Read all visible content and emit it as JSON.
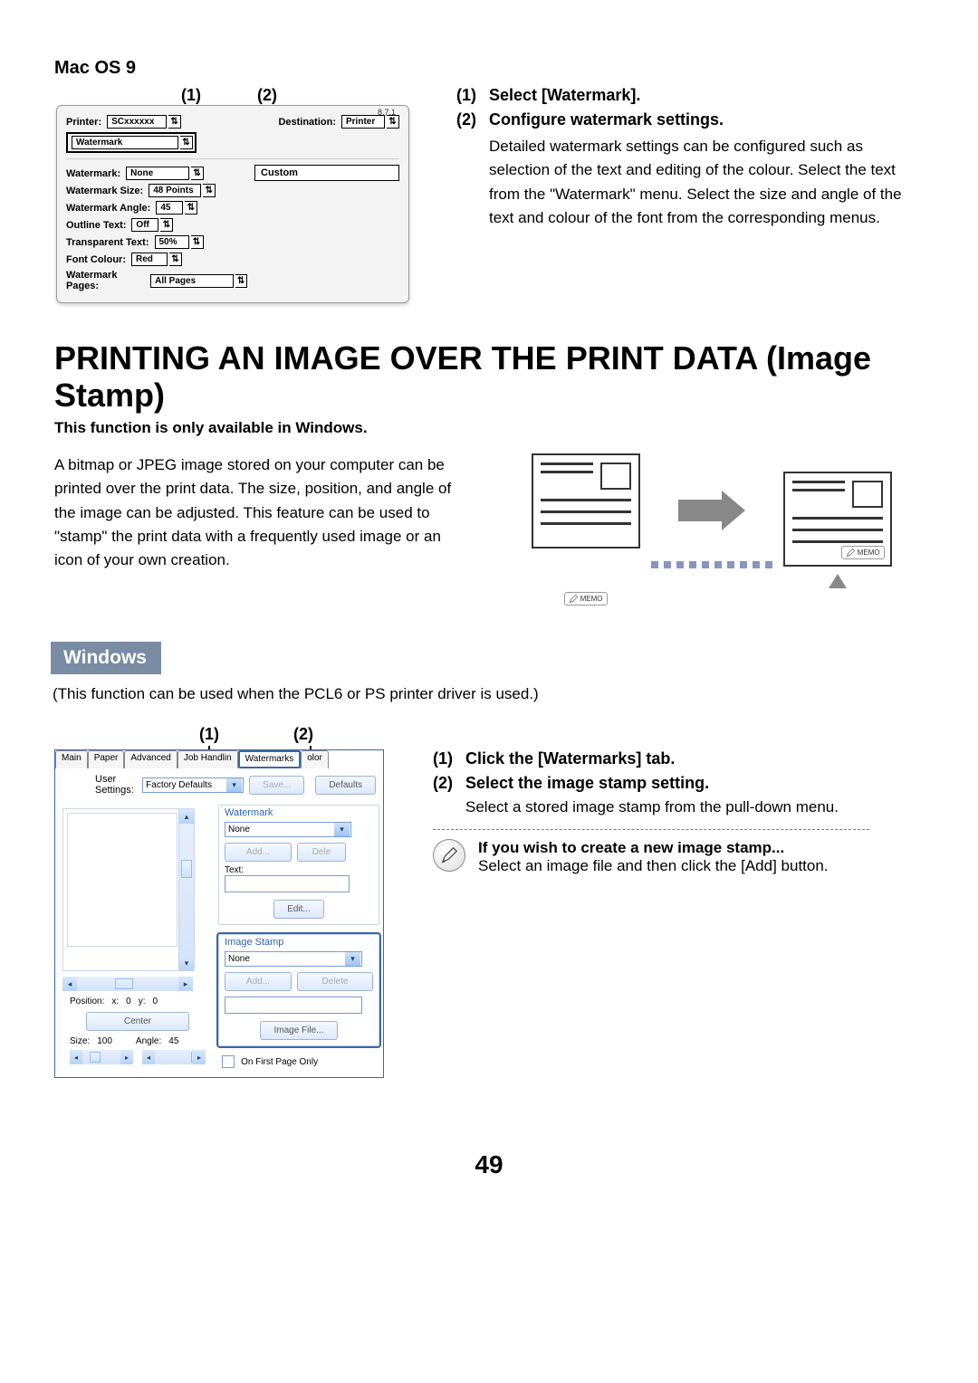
{
  "macos_label": "Mac OS 9",
  "callouts12": {
    "one": "(1)",
    "two": "(2)"
  },
  "macdlg": {
    "version": "8.7.1",
    "printer_label": "Printer:",
    "printer_value": "SCxxxxxx",
    "dest_label": "Destination:",
    "dest_value": "Printer",
    "panel_value": "Watermark",
    "wm_label": "Watermark:",
    "wm_value": "None",
    "custom_label": "Custom",
    "wmsize_label": "Watermark Size:",
    "wmsize_value": "48 Points",
    "wmangle_label": "Watermark Angle:",
    "wmangle_value": "45",
    "outline_label": "Outline Text:",
    "outline_value": "Off",
    "trans_label": "Transparent Text:",
    "trans_value": "50%",
    "font_label": "Font Colour:",
    "font_value": "Red",
    "pages_label": "Watermark Pages:",
    "pages_value": "All Pages"
  },
  "macsteps": {
    "s1": "Select [Watermark].",
    "s2": "Configure watermark settings.",
    "s2body": "Detailed watermark settings can be configured such as selection of the text and editing of the colour. Select the text from the \"Watermark\" menu. Select the size and angle of the text and colour of the font from the corresponding menus."
  },
  "h1": "PRINTING AN IMAGE OVER THE PRINT DATA (Image Stamp)",
  "subbold": "This function is only available in Windows.",
  "imgstamp_para": "A bitmap or JPEG image stored on your computer can be printed over the print data. The size, position, and angle of the image can be adjusted. This feature can be used to \"stamp\" the print data with a frequently used image or an icon of your own creation.",
  "memo": "MEMO",
  "win_banner": "Windows",
  "win_note": "(This function can be used when the PCL6 or PS printer driver is used.)",
  "windlg": {
    "tabs": [
      "Main",
      "Paper",
      "Advanced",
      "Job Handlin",
      "Watermarks",
      "olor"
    ],
    "us_label": "User Settings:",
    "us_value": "Factory Defaults",
    "save": "Save...",
    "defaults": "Defaults",
    "wm_group": "Watermark",
    "wm_dd": "None",
    "add": "Add...",
    "dele": "Dele",
    "text_label": "Text:",
    "edit": "Edit...",
    "is_group": "Image Stamp",
    "is_dd": "None",
    "delete": "Delete",
    "imgfile": "Image File...",
    "firstpage": "On First Page Only",
    "position": "Position:",
    "x": "x:",
    "xv": "0",
    "y": "y:",
    "yv": "0",
    "center": "Center",
    "size": "Size:",
    "sizev": "100",
    "angle": "Angle:",
    "anglev": "45"
  },
  "winsteps": {
    "s1": "Click the [Watermarks] tab.",
    "s2": "Select the image stamp setting.",
    "s2body": "Select a stored image stamp from the pull-down menu.",
    "tiptitle": "If you wish to create a new image stamp...",
    "tipbody": "Select an image file and then click the [Add] button."
  },
  "pagenum": "49"
}
